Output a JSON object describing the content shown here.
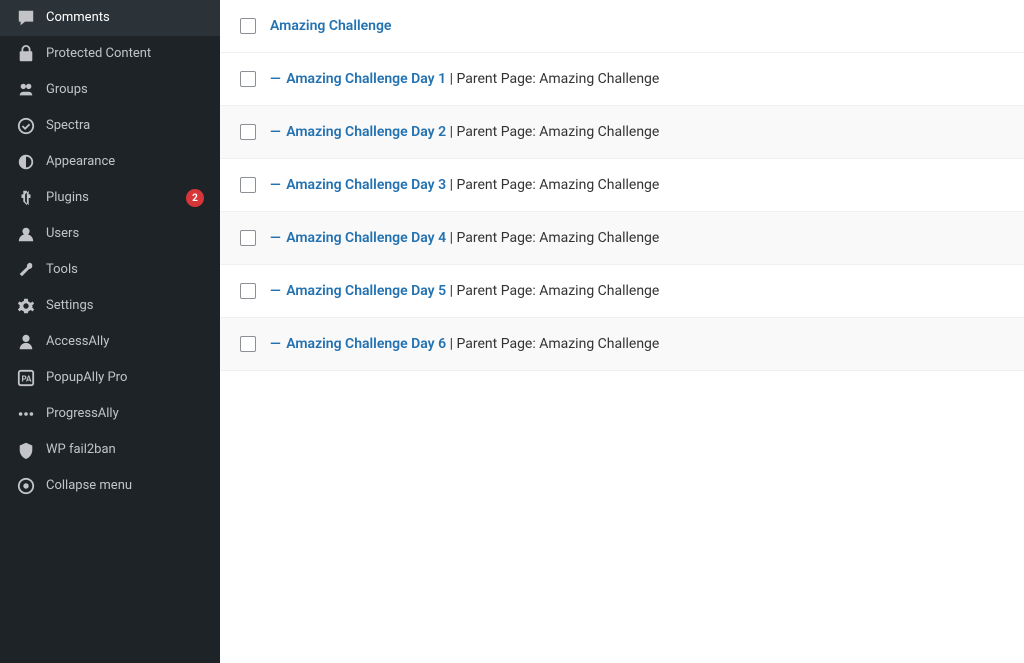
{
  "sidebar": {
    "items": [
      {
        "id": "comments",
        "label": "Comments",
        "icon": "💬"
      },
      {
        "id": "protected-content",
        "label": "Protected Content",
        "icon": "📁"
      },
      {
        "id": "groups",
        "label": "Groups",
        "icon": "✏️"
      },
      {
        "id": "spectra",
        "label": "Spectra",
        "icon": "⚡"
      },
      {
        "id": "appearance",
        "label": "Appearance",
        "icon": "🎨"
      },
      {
        "id": "plugins",
        "label": "Plugins",
        "icon": "🔌",
        "badge": "2"
      },
      {
        "id": "users",
        "label": "Users",
        "icon": "👤"
      },
      {
        "id": "tools",
        "label": "Tools",
        "icon": "🔧"
      },
      {
        "id": "settings",
        "label": "Settings",
        "icon": "⚙️"
      },
      {
        "id": "accessally",
        "label": "AccessAlly",
        "icon": "🔑"
      },
      {
        "id": "popupally-pro",
        "label": "PopupAlly Pro",
        "icon": "📋"
      },
      {
        "id": "progressally",
        "label": "ProgressAlly",
        "icon": "···"
      },
      {
        "id": "wp-fail2ban",
        "label": "WP fail2ban",
        "icon": "🛡️"
      },
      {
        "id": "collapse-menu",
        "label": "Collapse menu",
        "icon": "◉"
      }
    ]
  },
  "content": {
    "rows": [
      {
        "id": "row-0",
        "is_parent": true,
        "link_text": "Amazing Challenge",
        "parent_text": ""
      },
      {
        "id": "row-1",
        "is_parent": false,
        "link_text": "Amazing Challenge Day 1",
        "parent_text": "Parent Page: Amazing Challenge"
      },
      {
        "id": "row-2",
        "is_parent": false,
        "link_text": "Amazing Challenge Day 2",
        "parent_text": "Parent Page: Amazing Challenge"
      },
      {
        "id": "row-3",
        "is_parent": false,
        "link_text": "Amazing Challenge Day 3",
        "parent_text": "Parent Page: Amazing Challenge"
      },
      {
        "id": "row-4",
        "is_parent": false,
        "link_text": "Amazing Challenge Day 4",
        "parent_text": "Parent Page: Amazing Challenge"
      },
      {
        "id": "row-5",
        "is_parent": false,
        "link_text": "Amazing Challenge Day 5",
        "parent_text": "Parent Page: Amazing Challenge"
      },
      {
        "id": "row-6",
        "is_parent": false,
        "link_text": "Amazing Challenge Day 6",
        "parent_text": "Parent Page: Amazing Challenge"
      }
    ],
    "separator": "| ",
    "dash": "—"
  }
}
